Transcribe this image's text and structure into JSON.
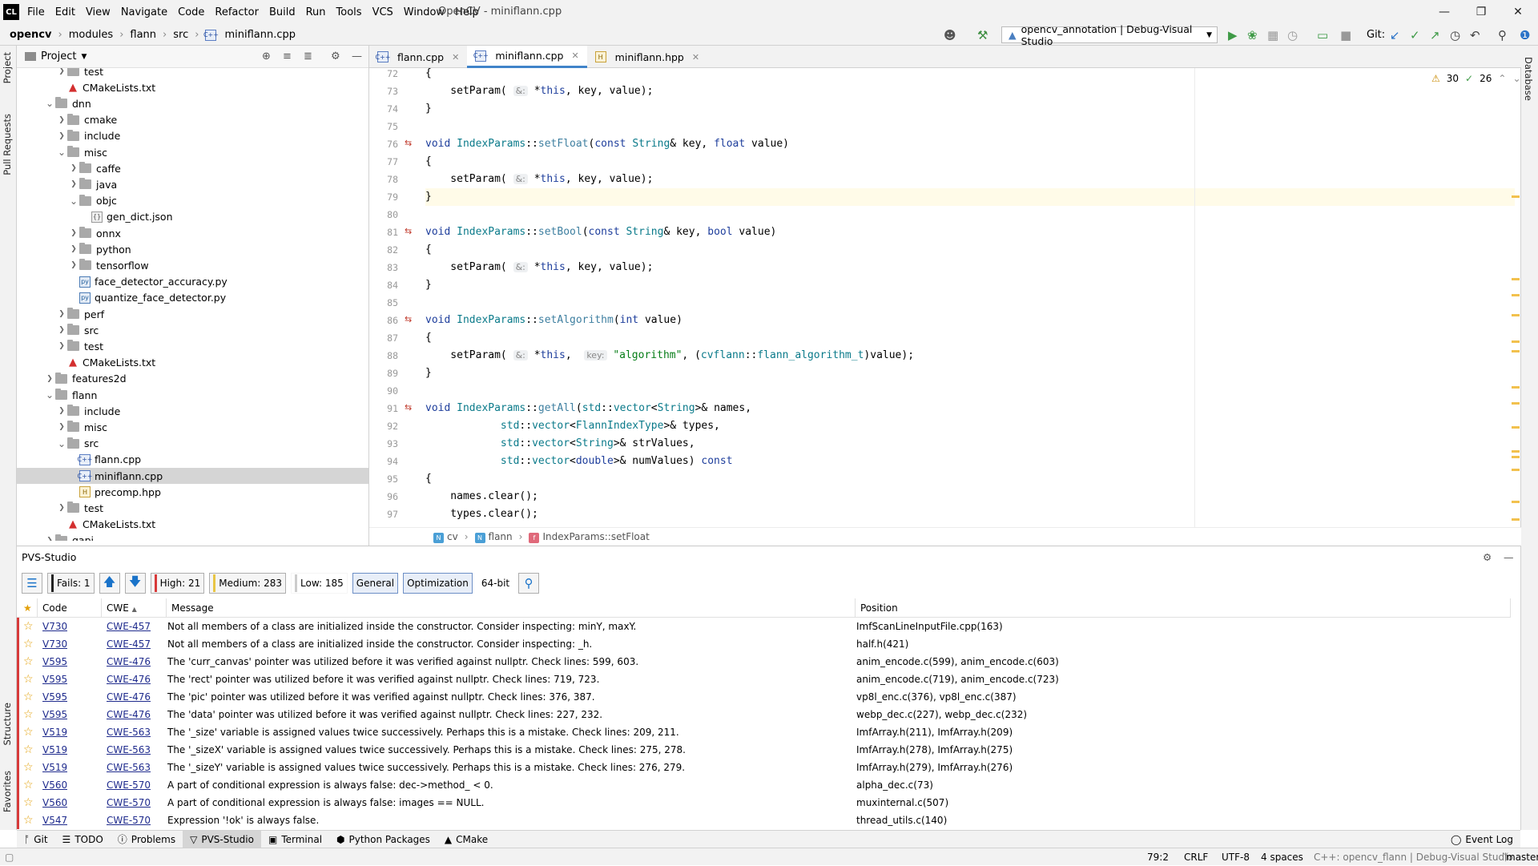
{
  "app": {
    "logo": "CL",
    "menu": [
      "File",
      "Edit",
      "View",
      "Navigate",
      "Code",
      "Refactor",
      "Build",
      "Run",
      "Tools",
      "VCS",
      "Window",
      "Help"
    ],
    "title": "OpenCV - miniflann.cpp"
  },
  "navbar": {
    "breadcrumbs": [
      "opencv",
      "modules",
      "flann",
      "src",
      "miniflann.cpp"
    ],
    "run_config": "opencv_annotation | Debug-Visual Studio",
    "git_label": "Git:"
  },
  "side_tabs": {
    "left_top": [
      "Project",
      "Pull Requests"
    ],
    "left_bottom": [
      "Structure",
      "Favorites"
    ],
    "right": [
      "Database"
    ]
  },
  "project": {
    "header": "Project",
    "tree": [
      {
        "label": "test",
        "type": "folder",
        "depth": 3,
        "state": "collapsed"
      },
      {
        "label": "CMakeLists.txt",
        "type": "cmake",
        "depth": 3,
        "state": "none"
      },
      {
        "label": "dnn",
        "type": "folder",
        "depth": 2,
        "state": "expanded"
      },
      {
        "label": "cmake",
        "type": "folder",
        "depth": 3,
        "state": "collapsed"
      },
      {
        "label": "include",
        "type": "folder",
        "depth": 3,
        "state": "collapsed"
      },
      {
        "label": "misc",
        "type": "folder",
        "depth": 3,
        "state": "expanded"
      },
      {
        "label": "caffe",
        "type": "folder",
        "depth": 4,
        "state": "collapsed"
      },
      {
        "label": "java",
        "type": "folder",
        "depth": 4,
        "state": "collapsed"
      },
      {
        "label": "objc",
        "type": "folder",
        "depth": 4,
        "state": "expanded"
      },
      {
        "label": "gen_dict.json",
        "type": "json",
        "depth": 5,
        "state": "none"
      },
      {
        "label": "onnx",
        "type": "folder",
        "depth": 4,
        "state": "collapsed"
      },
      {
        "label": "python",
        "type": "folder",
        "depth": 4,
        "state": "collapsed"
      },
      {
        "label": "tensorflow",
        "type": "folder",
        "depth": 4,
        "state": "collapsed"
      },
      {
        "label": "face_detector_accuracy.py",
        "type": "py",
        "depth": 4,
        "state": "none"
      },
      {
        "label": "quantize_face_detector.py",
        "type": "py",
        "depth": 4,
        "state": "none"
      },
      {
        "label": "perf",
        "type": "folder",
        "depth": 3,
        "state": "collapsed"
      },
      {
        "label": "src",
        "type": "folder",
        "depth": 3,
        "state": "collapsed"
      },
      {
        "label": "test",
        "type": "folder",
        "depth": 3,
        "state": "collapsed"
      },
      {
        "label": "CMakeLists.txt",
        "type": "cmake",
        "depth": 3,
        "state": "none"
      },
      {
        "label": "features2d",
        "type": "folder",
        "depth": 2,
        "state": "collapsed"
      },
      {
        "label": "flann",
        "type": "folder",
        "depth": 2,
        "state": "expanded"
      },
      {
        "label": "include",
        "type": "folder",
        "depth": 3,
        "state": "collapsed"
      },
      {
        "label": "misc",
        "type": "folder",
        "depth": 3,
        "state": "collapsed"
      },
      {
        "label": "src",
        "type": "folder",
        "depth": 3,
        "state": "expanded"
      },
      {
        "label": "flann.cpp",
        "type": "cpp",
        "depth": 4,
        "state": "none"
      },
      {
        "label": "miniflann.cpp",
        "type": "cpp",
        "depth": 4,
        "state": "none",
        "selected": true
      },
      {
        "label": "precomp.hpp",
        "type": "hpp",
        "depth": 4,
        "state": "none"
      },
      {
        "label": "test",
        "type": "folder",
        "depth": 3,
        "state": "collapsed"
      },
      {
        "label": "CMakeLists.txt",
        "type": "cmake",
        "depth": 3,
        "state": "none"
      },
      {
        "label": "gapi",
        "type": "folder",
        "depth": 2,
        "state": "collapsed"
      }
    ]
  },
  "editor": {
    "tabs": [
      {
        "label": "flann.cpp",
        "kind": "cpp",
        "active": false
      },
      {
        "label": "miniflann.cpp",
        "kind": "cpp",
        "active": true
      },
      {
        "label": "miniflann.hpp",
        "kind": "hpp",
        "active": false
      }
    ],
    "inspections": {
      "warnings": "30",
      "weak": "26"
    },
    "current_line": 79,
    "lines": [
      {
        "n": "72",
        "html": "{"
      },
      {
        "n": "73",
        "html": "    setParam( <span class=\"hint\">&amp;:</span> *<span class=\"kw\">this</span>, key, value);"
      },
      {
        "n": "74",
        "html": "}"
      },
      {
        "n": "75",
        "html": ""
      },
      {
        "n": "76",
        "html": "<span class=\"kw\">void</span> <span class=\"ty\">IndexParams</span>::<span class=\"fn\">setFloat</span>(<span class=\"kw\">const</span> <span class=\"ty\">String</span>&amp; key, <span class=\"kw\">float</span> value)"
      },
      {
        "n": "77",
        "html": "{"
      },
      {
        "n": "78",
        "html": "    setParam( <span class=\"hint\">&amp;:</span> *<span class=\"kw\">this</span>, key, value);"
      },
      {
        "n": "79",
        "html": "}"
      },
      {
        "n": "80",
        "html": ""
      },
      {
        "n": "81",
        "html": "<span class=\"kw\">void</span> <span class=\"ty\">IndexParams</span>::<span class=\"fn\">setBool</span>(<span class=\"kw\">const</span> <span class=\"ty\">String</span>&amp; key, <span class=\"kw\">bool</span> value)"
      },
      {
        "n": "82",
        "html": "{"
      },
      {
        "n": "83",
        "html": "    setParam( <span class=\"hint\">&amp;:</span> *<span class=\"kw\">this</span>, key, value);"
      },
      {
        "n": "84",
        "html": "}"
      },
      {
        "n": "85",
        "html": ""
      },
      {
        "n": "86",
        "html": "<span class=\"kw\">void</span> <span class=\"ty\">IndexParams</span>::<span class=\"fn\">setAlgorithm</span>(<span class=\"kw\">int</span> value)"
      },
      {
        "n": "87",
        "html": "{"
      },
      {
        "n": "88",
        "html": "    setParam( <span class=\"hint\">&amp;:</span> *<span class=\"kw\">this</span>,  <span class=\"hint\">key:</span> <span class=\"str\">\"algorithm\"</span>, (<span class=\"ty\">cvflann</span>::<span class=\"ty\">flann_algorithm_t</span>)value);"
      },
      {
        "n": "89",
        "html": "}"
      },
      {
        "n": "90",
        "html": ""
      },
      {
        "n": "91",
        "html": "<span class=\"kw\">void</span> <span class=\"ty\">IndexParams</span>::<span class=\"fn\">getAll</span>(<span class=\"ty\">std</span>::<span class=\"ty\">vector</span>&lt;<span class=\"ty\">String</span>&gt;&amp; names,"
      },
      {
        "n": "92",
        "html": "            <span class=\"ty\">std</span>::<span class=\"ty\">vector</span>&lt;<span class=\"ty\">FlannIndexType</span>&gt;&amp; types,"
      },
      {
        "n": "93",
        "html": "            <span class=\"ty\">std</span>::<span class=\"ty\">vector</span>&lt;<span class=\"ty\">String</span>&gt;&amp; strValues,"
      },
      {
        "n": "94",
        "html": "            <span class=\"ty\">std</span>::<span class=\"ty\">vector</span>&lt;<span class=\"kw\">double</span>&gt;&amp; numValues) <span class=\"kw\">const</span>"
      },
      {
        "n": "95",
        "html": "{"
      },
      {
        "n": "96",
        "html": "    names.clear();"
      },
      {
        "n": "97",
        "html": "    types.clear();"
      }
    ],
    "breadcrumbs": [
      {
        "badge": "N",
        "label": "cv",
        "color": "#4a9fd6"
      },
      {
        "badge": "N",
        "label": "flann",
        "color": "#4a9fd6"
      },
      {
        "badge": "f",
        "label": "IndexParams::setFloat",
        "color": "#e0697a"
      }
    ]
  },
  "pvs": {
    "title": "PVS-Studio",
    "toolbar": {
      "fails": "Fails: 1",
      "high": "High: 21",
      "medium": "Medium: 283",
      "low": "Low: 185",
      "general": "General",
      "optimization": "Optimization",
      "bits": "64-bit"
    },
    "columns": [
      "Code",
      "CWE",
      "Message",
      "Position"
    ],
    "rows": [
      {
        "code": "V730",
        "cwe": "CWE-457",
        "message": "Not all members of a class are initialized inside the constructor. Consider inspecting: minY, maxY.",
        "position": "ImfScanLineInputFile.cpp(163)"
      },
      {
        "code": "V730",
        "cwe": "CWE-457",
        "message": "Not all members of a class are initialized inside the constructor. Consider inspecting: _h.",
        "position": "half.h(421)"
      },
      {
        "code": "V595",
        "cwe": "CWE-476",
        "message": "The 'curr_canvas' pointer was utilized before it was verified against nullptr. Check lines: 599, 603.",
        "position": "anim_encode.c(599), anim_encode.c(603)"
      },
      {
        "code": "V595",
        "cwe": "CWE-476",
        "message": "The 'rect' pointer was utilized before it was verified against nullptr. Check lines: 719, 723.",
        "position": "anim_encode.c(719), anim_encode.c(723)"
      },
      {
        "code": "V595",
        "cwe": "CWE-476",
        "message": "The 'pic' pointer was utilized before it was verified against nullptr. Check lines: 376, 387.",
        "position": "vp8l_enc.c(376), vp8l_enc.c(387)"
      },
      {
        "code": "V595",
        "cwe": "CWE-476",
        "message": "The 'data' pointer was utilized before it was verified against nullptr. Check lines: 227, 232.",
        "position": "webp_dec.c(227), webp_dec.c(232)"
      },
      {
        "code": "V519",
        "cwe": "CWE-563",
        "message": "The '_size' variable is assigned values twice successively. Perhaps this is a mistake. Check lines: 209, 211.",
        "position": "ImfArray.h(211), ImfArray.h(209)"
      },
      {
        "code": "V519",
        "cwe": "CWE-563",
        "message": "The '_sizeX' variable is assigned values twice successively. Perhaps this is a mistake. Check lines: 275, 278.",
        "position": "ImfArray.h(278), ImfArray.h(275)"
      },
      {
        "code": "V519",
        "cwe": "CWE-563",
        "message": "The '_sizeY' variable is assigned values twice successively. Perhaps this is a mistake. Check lines: 276, 279.",
        "position": "ImfArray.h(279), ImfArray.h(276)"
      },
      {
        "code": "V560",
        "cwe": "CWE-570",
        "message": "A part of conditional expression is always false: dec->method_ < 0.",
        "position": "alpha_dec.c(73)"
      },
      {
        "code": "V560",
        "cwe": "CWE-570",
        "message": "A part of conditional expression is always false: images == NULL.",
        "position": "muxinternal.c(507)"
      },
      {
        "code": "V547",
        "cwe": "CWE-570",
        "message": "Expression '!ok' is always false.",
        "position": "thread_utils.c(140)"
      }
    ]
  },
  "bottom_tabs": [
    "Git",
    "TODO",
    "Problems",
    "PVS-Studio",
    "Terminal",
    "Python Packages",
    "CMake"
  ],
  "bottom_active": "PVS-Studio",
  "event_log": "Event Log",
  "status": {
    "position": "79:2",
    "line_sep": "CRLF",
    "encoding": "UTF-8",
    "indent": "4 spaces",
    "context": "C++: opencv_flann | Debug-Visual Studio",
    "branch": "master"
  },
  "colors": {
    "accent": "#4083c9",
    "high": "#d73a3a",
    "medium": "#e8c545",
    "low": "#cccccc",
    "selection": "#d5d5d5"
  }
}
